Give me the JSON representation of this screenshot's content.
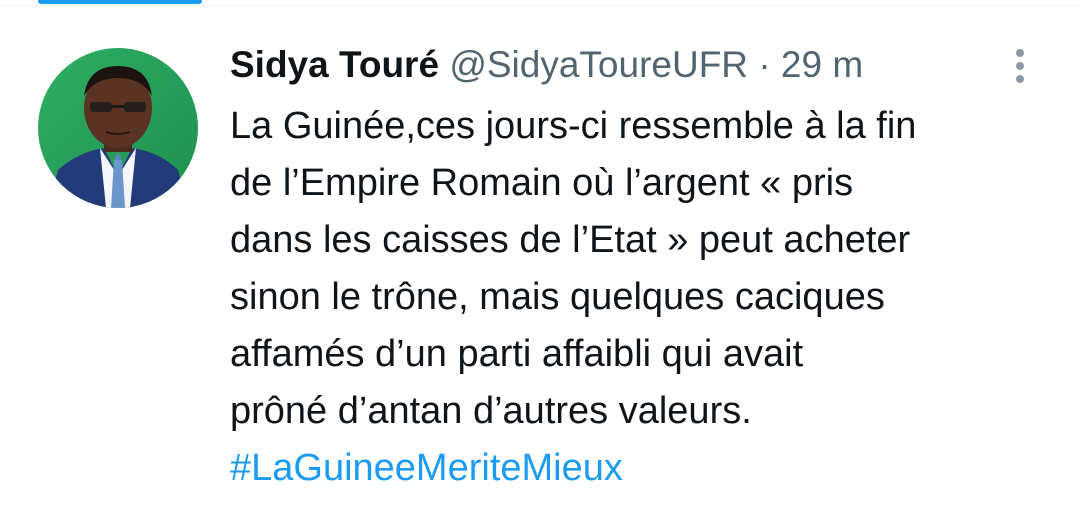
{
  "tweet": {
    "author": {
      "display_name": "Sidya Touré",
      "handle": "@SidyaToureUFR",
      "avatar_icon": "profile-photo"
    },
    "separator": "·",
    "time": "29 m",
    "menu_icon": "more-vertical-icon",
    "body_lines": [
      "La Guinée,ces jours-ci ressemble à la fin",
      "de l’Empire Romain où l’argent « pris",
      "dans les caisses de l’Etat » peut acheter",
      "sinon le trône, mais quelques caciques",
      "affamés d’un parti affaibli qui avait",
      "prôné d’antan d’autres valeurs."
    ],
    "hashtag": "#LaGuineeMeriteMieux"
  },
  "colors": {
    "accent": "#1d9bf0",
    "text": "#0f1419",
    "secondary": "#536471"
  }
}
